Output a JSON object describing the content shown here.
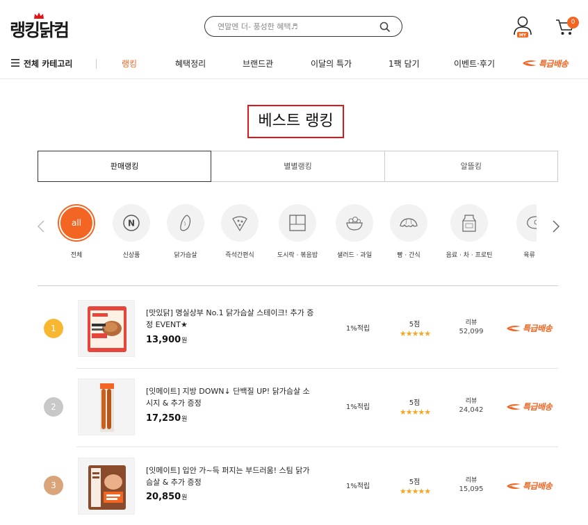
{
  "header": {
    "logo_text": "랭킹닭컴",
    "search_placeholder": "연말엔 더- 풍성한 혜택♬",
    "my_label": "MY",
    "cart_count": "0"
  },
  "nav": {
    "all_categories": "전체 카테고리",
    "items": [
      "랭킹",
      "혜택정리",
      "브랜드관",
      "이달의 특가",
      "1팩 담기",
      "이벤트·후기"
    ],
    "express": "특급배송",
    "accent_color": "#f26522"
  },
  "page_title": "베스트 랭킹",
  "tabs": [
    "판매랭킹",
    "별별랭킹",
    "알뜰킹"
  ],
  "categories": [
    {
      "label": "전체",
      "icon": "all",
      "icon_text": "all"
    },
    {
      "label": "신상품",
      "icon": "new-icon",
      "icon_text": "N"
    },
    {
      "label": "닭가슴살",
      "icon": "chicken-breast-icon"
    },
    {
      "label": "즉석간편식",
      "icon": "pizza-icon"
    },
    {
      "label": "도시락 · 볶음밥",
      "icon": "lunchbox-icon"
    },
    {
      "label": "샐러드 · 과일",
      "icon": "salad-icon"
    },
    {
      "label": "빵 · 간식",
      "icon": "croissant-icon"
    },
    {
      "label": "음료 · 차 · 프로틴",
      "icon": "milk-icon"
    },
    {
      "label": "육류 · 달",
      "icon": "steak-icon"
    }
  ],
  "products": [
    {
      "rank": "1",
      "rank_color": "#f7b731",
      "name": "[맛있닭] 명실상부 No.1 닭가슴살 스테이크! 추가 증정 EVENT★",
      "price": "13,900",
      "won": "원",
      "point": "1%적립",
      "score": "5점",
      "stars": "★★★★★",
      "review_label": "리뷰",
      "review_count": "52,099",
      "express": "특급배송"
    },
    {
      "rank": "2",
      "rank_color": "#c8c8c8",
      "name": "[잇메이트] 지방 DOWN↓ 단백질 UP! 닭가슴살 소시지 & 추가 증정",
      "price": "17,250",
      "won": "원",
      "point": "1%적립",
      "score": "5점",
      "stars": "★★★★★",
      "review_label": "리뷰",
      "review_count": "24,042",
      "express": "특급배송"
    },
    {
      "rank": "3",
      "rank_color": "#d9a47a",
      "name": "[잇메이트] 입안 가~득 퍼지는 부드러움! 스팀 닭가슴살 & 추가 증정",
      "price": "20,850",
      "won": "원",
      "point": "1%적립",
      "score": "5점",
      "stars": "★★★★★",
      "review_label": "리뷰",
      "review_count": "15,095",
      "express": "특급배송"
    }
  ]
}
